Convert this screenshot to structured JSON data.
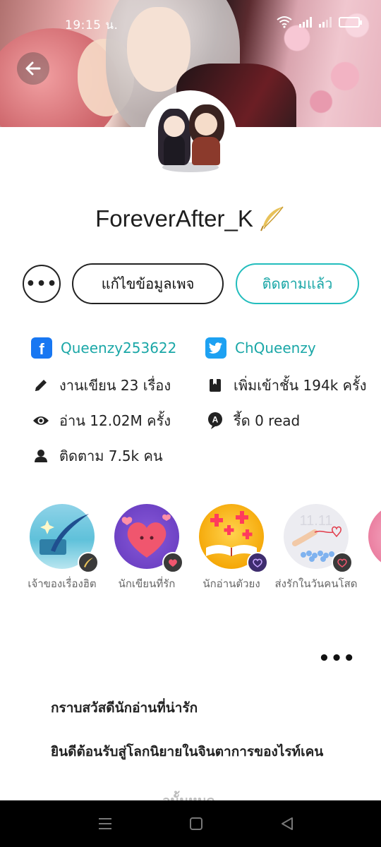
{
  "status": {
    "time": "19:15 น."
  },
  "profile": {
    "username": "ForeverAfter_K",
    "actions": {
      "more_label": "•••",
      "edit_label": "แก้ไขข้อมูลเพจ",
      "follow_label": "ติดตามแล้ว"
    }
  },
  "info": {
    "facebook": "Queenzy253622",
    "twitter": "ChQueenzy",
    "works": "งานเขียน 23 เรื่อง",
    "shelf": "เพิ่มเข้าชั้น 194k ครั้ง",
    "reads": "อ่าน 12.02M ครั้ง",
    "reed": "รี้ด 0 read",
    "followers": "ติดตาม 7.5k คน"
  },
  "badges": [
    {
      "label": "เจ้าของเรื่องฮิต",
      "icon": "quill-icon",
      "color": "#3fb0c9"
    },
    {
      "label": "นักเขียนที่รัก",
      "icon": "heart-icon",
      "color": "#7a4fd6"
    },
    {
      "label": "นักอ่านตัวยง",
      "icon": "book-icon",
      "color": "#f4b400"
    },
    {
      "label": "ส่งรักในวันคนโสด",
      "icon": "heart-hand-icon",
      "color": "#e9e9ee"
    }
  ],
  "bio": {
    "more_label": "•••",
    "line1": "กราบสวัสดีนักอ่านที่น่ารัก",
    "line2": "ยินดีต้อนรับสู่โลกนิยายในจินตาการของไรท์เคน",
    "line3": "อนั้นหมด"
  }
}
